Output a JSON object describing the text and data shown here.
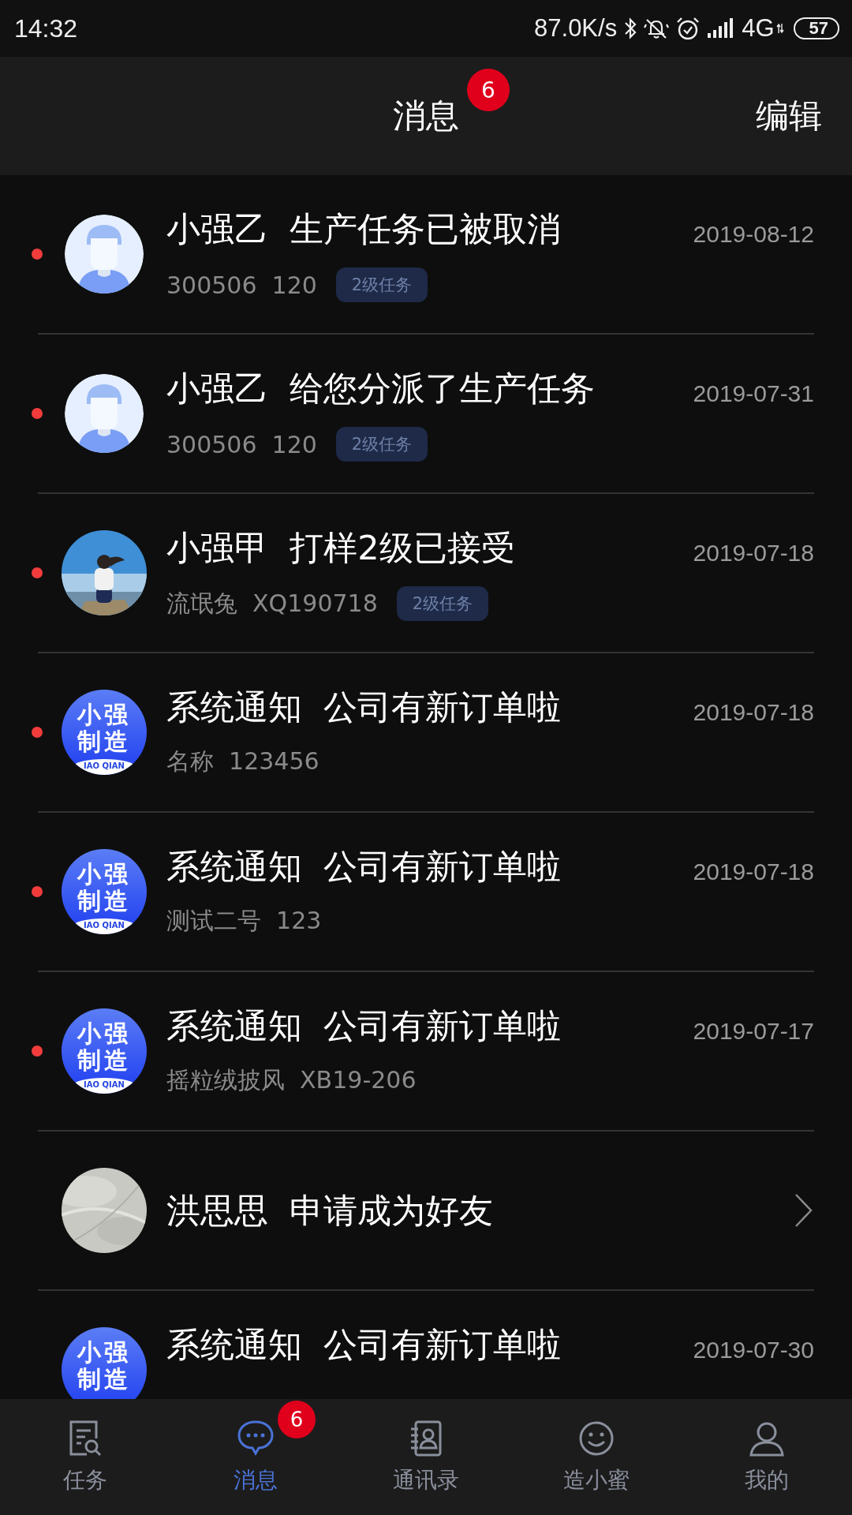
{
  "status_bar": {
    "time": "14:32",
    "net_speed": "87.0K/s",
    "network": "4G",
    "battery": "57"
  },
  "header": {
    "title": "消息",
    "badge": "6",
    "action": "编辑"
  },
  "messages": [
    {
      "kind": "task",
      "unread": true,
      "avatar": {
        "kind": "person"
      },
      "sender": "小强乙",
      "text": "生产任务已被取消",
      "date": "2019-08-12",
      "meta": [
        "300506",
        "120"
      ],
      "tag": "2级任务"
    },
    {
      "kind": "task",
      "unread": true,
      "avatar": {
        "kind": "person"
      },
      "sender": "小强乙",
      "text": "给您分派了生产任务",
      "date": "2019-07-31",
      "meta": [
        "300506",
        "120"
      ],
      "tag": "2级任务"
    },
    {
      "kind": "task",
      "unread": true,
      "sender": "小强甲",
      "text": "打样2级已接受",
      "date": "2019-07-18",
      "meta": [
        "流氓兔",
        "XQ190718"
      ],
      "tag": "2级任务"
    },
    {
      "kind": "task",
      "unread": true,
      "avatar": {
        "kind": "logo",
        "lines": [
          "小强",
          "制造"
        ],
        "sub": "IAO QIAN"
      },
      "sender": "系统通知",
      "text": "公司有新订单啦",
      "date": "2019-07-18",
      "meta": [
        "名称",
        "123456"
      ]
    },
    {
      "kind": "task",
      "unread": true,
      "avatar": {
        "kind": "logo",
        "lines": [
          "小强",
          "制造"
        ],
        "sub": "IAO QIAN"
      },
      "sender": "系统通知",
      "text": "公司有新订单啦",
      "date": "2019-07-18",
      "meta": [
        "测试二号",
        "123"
      ]
    },
    {
      "kind": "task",
      "unread": true,
      "avatar": {
        "kind": "logo",
        "lines": [
          "小强",
          "制造"
        ],
        "sub": "IAO QIAN"
      },
      "sender": "系统通知",
      "text": "公司有新订单啦",
      "date": "2019-07-17",
      "meta": [
        "摇粒绒披风",
        "XB19-206"
      ]
    },
    {
      "kind": "friend_request",
      "unread": false,
      "sender": "洪思思",
      "text": "申请成为好友"
    },
    {
      "kind": "task",
      "unread": false,
      "avatar": {
        "kind": "logo",
        "lines": [
          "小强",
          "制造"
        ]
      },
      "sender": "系统通知",
      "text": "公司有新订单啦",
      "date": "2019-07-30"
    }
  ],
  "tabs": [
    {
      "label": "任务",
      "selected": false
    },
    {
      "label": "消息",
      "selected": true,
      "badge": "6"
    },
    {
      "label": "通讯录",
      "selected": false
    },
    {
      "label": "造小蜜",
      "selected": false
    },
    {
      "label": "我的",
      "selected": false
    }
  ]
}
